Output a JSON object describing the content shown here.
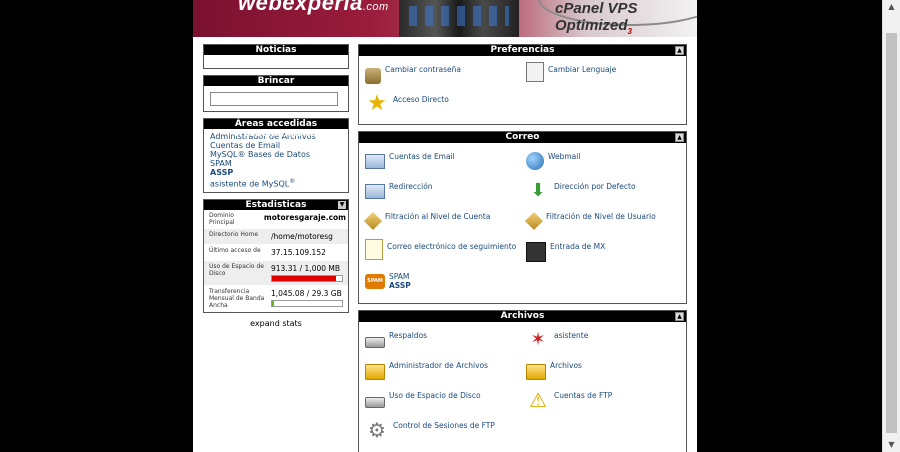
{
  "banner": {
    "logo_text": "webexperia",
    "logo_suffix": ".com",
    "cpanel_label": "cPanel VPS Optimized",
    "cpanel_version": "3"
  },
  "noticias": {
    "title": "Noticias"
  },
  "brincar": {
    "title": "Brincar",
    "input_value": ""
  },
  "frequent": {
    "title": "Áreas accedidas frecuentemente",
    "links": [
      {
        "label": "Administrador de Archivos",
        "bold": false
      },
      {
        "label": "Cuentas de Email",
        "bold": false
      },
      {
        "label": "MySQL® Bases de Datos",
        "bold": false
      },
      {
        "label": "SPAM",
        "bold": false
      },
      {
        "label": "ASSP",
        "bold": true
      },
      {
        "label": "asistente de MySQL",
        "bold": false,
        "sup": "®"
      }
    ]
  },
  "stats": {
    "title": "Estadisticas",
    "rows": [
      {
        "label": "Dominio Principal",
        "value": "motoresgaraje.com"
      },
      {
        "label": "Directorio Home",
        "value": "/home/motoresg"
      },
      {
        "label": "Último acceso de",
        "value": "37.15.109.152"
      },
      {
        "label": "Uso de Espacio de Disco",
        "value": "913.31 / 1,000 MB",
        "fill": 0.913,
        "fill_color": "#e00000"
      },
      {
        "label": "Transferencia Mensual de Banda Ancha",
        "value": "1,045.08 / 29.3 GB",
        "fill": 0.035,
        "fill_color": "#5cc000"
      }
    ],
    "expand_label": "expand stats"
  },
  "preferencias": {
    "title": "Preferencias",
    "items": [
      {
        "label": "Cambiar contraseña",
        "icon": "lock-icon"
      },
      {
        "label": "Cambiar Lenguaje",
        "icon": "language-icon"
      },
      {
        "label": "Acceso Directo",
        "icon": "star-icon"
      }
    ]
  },
  "correo": {
    "title": "Correo",
    "items": [
      {
        "label": "Cuentas de Email",
        "icon": "mail-icon"
      },
      {
        "label": "Webmail",
        "icon": "globe-icon"
      },
      {
        "label": "Redirección",
        "icon": "forward-mail-icon"
      },
      {
        "label": "Dirección por Defecto",
        "icon": "arrow-down-icon"
      },
      {
        "label": "Filtración al Nivel de Cuenta",
        "icon": "filter-icon"
      },
      {
        "label": "Filtración de Nivel de Usuario",
        "icon": "user-filter-icon"
      },
      {
        "label": "Correo electrónico de seguimiento",
        "icon": "document-icon"
      },
      {
        "label": "Entrada de MX",
        "icon": "mx-icon"
      },
      {
        "label": "SPAM",
        "label2": "ASSP",
        "icon": "spam-icon"
      }
    ]
  },
  "archivos": {
    "title": "Archivos",
    "items": [
      {
        "label": "Respaldos",
        "icon": "disk-icon"
      },
      {
        "label": "asistente",
        "icon": "wizard-icon"
      },
      {
        "label": "Administrador de Archivos",
        "icon": "folder-icon"
      },
      {
        "label": "Archivos",
        "icon": "folder-icon"
      },
      {
        "label": "Uso de Espacio de Disco",
        "icon": "disk-icon"
      },
      {
        "label": "Cuentas de FTP",
        "icon": "warning-icon"
      },
      {
        "label": "Control de Sesiones de FTP",
        "icon": "gear-icon"
      }
    ]
  }
}
